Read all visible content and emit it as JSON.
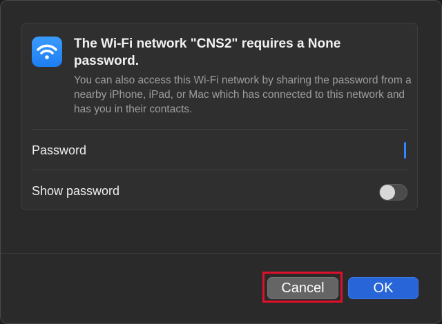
{
  "dialog": {
    "title": "The Wi-Fi network \"CNS2\" requires a None password.",
    "description": "You can also access this Wi-Fi network by sharing the password from a nearby iPhone, iPad, or Mac which has connected to this network and has you in their contacts.",
    "icon": "wifi-icon",
    "accent_color": "#2f86ff"
  },
  "form": {
    "password_label": "Password",
    "password_value": "",
    "show_password_label": "Show password",
    "show_password_on": false
  },
  "buttons": {
    "cancel_label": "Cancel",
    "ok_label": "OK",
    "ok_color": "#2865d8",
    "highlight_color": "#e0102a"
  }
}
